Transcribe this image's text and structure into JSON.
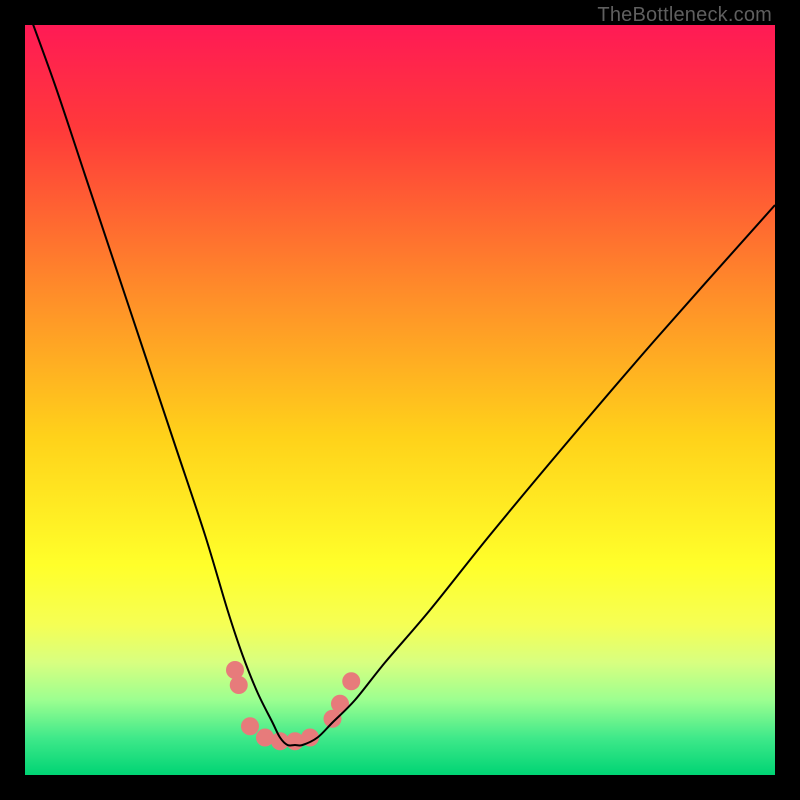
{
  "watermark": "TheBottleneck.com",
  "chart_data": {
    "type": "line",
    "title": "",
    "xlabel": "",
    "ylabel": "",
    "xlim": [
      0,
      100
    ],
    "ylim": [
      0,
      100
    ],
    "grid": false,
    "legend": false,
    "background": {
      "kind": "vertical-gradient",
      "stops": [
        {
          "pct": 0,
          "color": "#ff1a55"
        },
        {
          "pct": 14,
          "color": "#ff3a3a"
        },
        {
          "pct": 35,
          "color": "#ff8a2a"
        },
        {
          "pct": 55,
          "color": "#ffd21a"
        },
        {
          "pct": 72,
          "color": "#ffff2a"
        },
        {
          "pct": 80,
          "color": "#f5ff55"
        },
        {
          "pct": 85,
          "color": "#d8ff80"
        },
        {
          "pct": 90,
          "color": "#9cff90"
        },
        {
          "pct": 95,
          "color": "#40e98a"
        },
        {
          "pct": 100,
          "color": "#00d474"
        }
      ]
    },
    "series": [
      {
        "name": "bottleneck-curve",
        "color": "#000000",
        "stroke_width": 2,
        "x": [
          0,
          4,
          8,
          12,
          16,
          20,
          24,
          27,
          29,
          31,
          33,
          34,
          35,
          36,
          37,
          39,
          41,
          44,
          48,
          54,
          62,
          72,
          84,
          100
        ],
        "y": [
          103,
          92,
          80,
          68,
          56,
          44,
          32,
          22,
          16,
          11,
          7,
          5,
          4,
          4,
          4,
          5,
          7,
          10,
          15,
          22,
          32,
          44,
          58,
          76
        ]
      }
    ],
    "markers": {
      "name": "highlight-dots",
      "color": "#e77b7b",
      "radius": 9,
      "points": [
        {
          "x": 28.0,
          "y": 14.0
        },
        {
          "x": 28.5,
          "y": 12.0
        },
        {
          "x": 30.0,
          "y": 6.5
        },
        {
          "x": 32.0,
          "y": 5.0
        },
        {
          "x": 34.0,
          "y": 4.5
        },
        {
          "x": 36.0,
          "y": 4.5
        },
        {
          "x": 38.0,
          "y": 5.0
        },
        {
          "x": 41.0,
          "y": 7.5
        },
        {
          "x": 42.0,
          "y": 9.5
        },
        {
          "x": 43.5,
          "y": 12.5
        }
      ]
    }
  }
}
